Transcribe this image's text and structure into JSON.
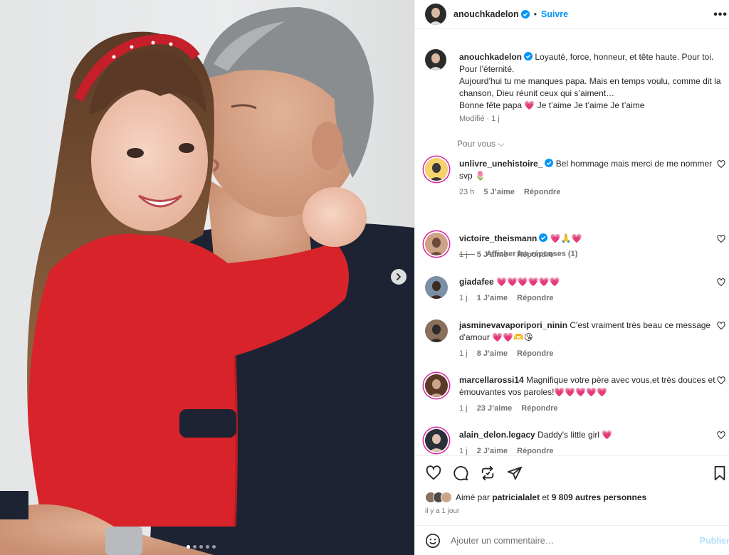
{
  "post": {
    "author": "anouchkadelon",
    "follow_label": "Suivre",
    "bullet": "•",
    "more_label": "•••",
    "caption": "Loyauté, force, honneur, et tête haute. Pour toi. Pour l’éternité.\nAujourd’hui tu me manques papa. Mais en temps voulu, comme dit la chanson, Dieu réunit ceux qui s’aiment…\nBonne fête papa 💗 Je t’aime Je t’aime Je t’aime",
    "caption_meta": "Modifié · 1 j",
    "for_you": "Pour vous ⌵",
    "photo_dots": 5,
    "photo_active_dot": 0
  },
  "comments": [
    {
      "user": "unlivre_unehistoire_",
      "verified": true,
      "text": "Bel hommage mais merci de me nommer svp 🌷",
      "time": "23 h",
      "likes": "5 J’aime",
      "reply": "Répondre"
    },
    {
      "user": "victoire_theismann",
      "verified": true,
      "text": "💗🙏💗",
      "time": "1 j",
      "likes": "5 J’aime",
      "reply": "Répondre"
    },
    {
      "user": "giadafee",
      "verified": false,
      "text": "💗💗💗💗💗💗",
      "time": "1 j",
      "likes": "1 J’aime",
      "reply": "Répondre"
    },
    {
      "user": "jasminevavaporipori_ninin",
      "verified": false,
      "text": "C'est vraiment très beau ce message d'amour 💗💗🫶😘",
      "time": "1 j",
      "likes": "8 J’aime",
      "reply": "Répondre"
    },
    {
      "user": "marcellarossi14",
      "verified": false,
      "text": "Magnifique votre père avec vous,et très douces et émouvantes vos paroles!💗💗💗💗💗",
      "time": "1 j",
      "likes": "23 J’aime",
      "reply": "Répondre"
    },
    {
      "user": "alain_delon.legacy",
      "verified": false,
      "text": "Daddy's little girl 💗",
      "time": "1 j",
      "likes": "2 J’aime",
      "reply": "Répondre"
    }
  ],
  "show_replies": "Afficher les réponses (1)",
  "likes": {
    "prefix": "Aimé par",
    "user": "patricialalet",
    "middle": "et",
    "count": "9 809 autres personnes"
  },
  "timestamp": "il y a 1 jour",
  "add_comment": {
    "placeholder": "Ajouter un commentaire…",
    "publish": "Publier"
  },
  "colors": {
    "accent": "#0095f6",
    "heart": "#ed4956",
    "muted": "#737373",
    "sweater": "#d8232a",
    "jacket": "#1d2333"
  },
  "icons": [
    "verified-icon",
    "more-icon",
    "heart-icon",
    "comment-icon",
    "repost-icon",
    "share-icon",
    "bookmark-icon",
    "emoji-icon",
    "chevron-right-icon"
  ]
}
